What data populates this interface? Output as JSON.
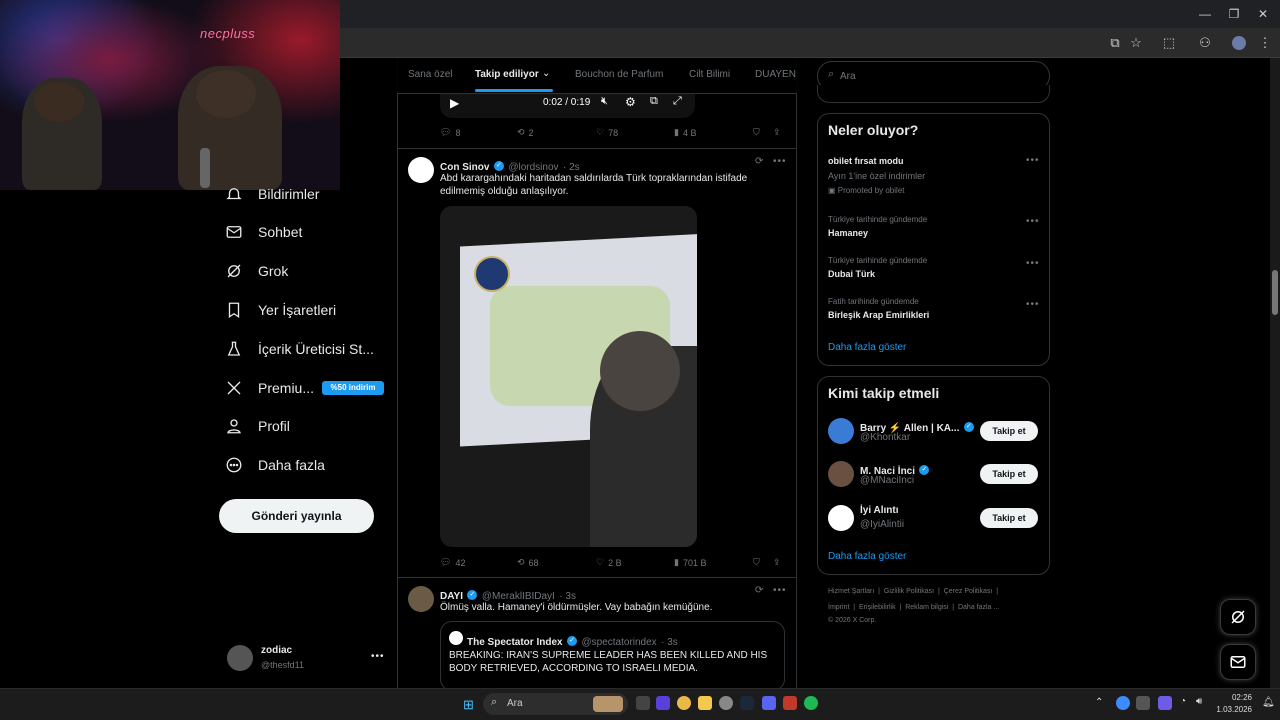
{
  "webcam": {
    "logo": "necpluss"
  },
  "nav": {
    "items": [
      {
        "label": "Bildirimler"
      },
      {
        "label": "Sohbet"
      },
      {
        "label": "Grok"
      },
      {
        "label": "Yer İşaretleri"
      },
      {
        "label": "İçerik Üreticisi St..."
      },
      {
        "label": "Premiu..."
      },
      {
        "label": "Profil"
      },
      {
        "label": "Daha fazla"
      }
    ],
    "premium_badge": "%50 indirim",
    "post_button": "Gönderi yayınla",
    "account": {
      "name": "zodiac",
      "handle": "@thesfd11"
    }
  },
  "feed": {
    "tabs": [
      "Sana özel",
      "Takip ediliyor",
      "Bouchon de Parfum",
      "Cilt Bilimi",
      "DUAYEN"
    ],
    "prev_tweet": {
      "time": "0:02 / 0:19",
      "replies": "8",
      "retweets": "2",
      "likes": "78",
      "views": "4 B"
    },
    "tweet1": {
      "name": "Con Sinov",
      "handle": "@lordsinov",
      "time": "· 2s",
      "text": "Abd karargahındaki haritadan saldırılarda Türk topraklarından istifade edilmemiş olduğu anlaşılıyor.",
      "replies": "42",
      "retweets": "68",
      "likes": "2 B",
      "views": "701 B"
    },
    "tweet2": {
      "name": "DAYI",
      "handle": "@MeraklIBIDayI",
      "time": "· 3s",
      "text": "Ölmüş valla. Hamaney'i öldürmüşler. Vay babağın kemüğüne.",
      "quote": {
        "name": "The Spectator Index",
        "handle": "@spectatorindex",
        "time": "· 3s",
        "text": "BREAKING: IRAN'S SUPREME LEADER HAS BEEN KILLED AND HIS BODY RETRIEVED, ACCORDING TO ISRAELI MEDIA."
      }
    }
  },
  "sidebar": {
    "search_placeholder": "Ara",
    "trends_title": "Neler oluyor?",
    "trends": [
      {
        "title": "obilet fırsat modu",
        "subtitle": "Ayın 1'ine özel indirimler",
        "promo": "Promoted by obilet"
      },
      {
        "meta": "Türkiye tarihinde gündemde",
        "title": "Hamaney"
      },
      {
        "meta": "Türkiye tarihinde gündemde",
        "title": "Dubai Türk"
      },
      {
        "meta": "Fatih tarihinde gündemde",
        "title": "Birleşik Arap Emirlikleri"
      }
    ],
    "show_more": "Daha fazla göster",
    "who_to_follow_title": "Kimi takip etmeli",
    "follow": [
      {
        "name": "Barry ⚡ Allen | KA...",
        "handle": "@Khontkar"
      },
      {
        "name": "M. Naci İnci",
        "handle": "@MNaciInci"
      },
      {
        "name": "İyi Alıntı",
        "handle": "@IyiAlintii"
      }
    ],
    "follow_button": "Takip et",
    "footer": {
      "links1": [
        "Hizmet Şartları",
        "Gizlilik Politikası",
        "Çerez Politikası"
      ],
      "links2": [
        "İmprint",
        "Erişilebilirlik",
        "Reklam bilgisi",
        "Daha fazla ..."
      ],
      "copyright": "© 2026 X Corp."
    }
  },
  "taskbar": {
    "search": "Ara",
    "time": "02:26",
    "date": "1.03.2026"
  },
  "colors": {
    "accent": "#1d9bf0",
    "background": "#000000",
    "muted": "#71767b"
  }
}
